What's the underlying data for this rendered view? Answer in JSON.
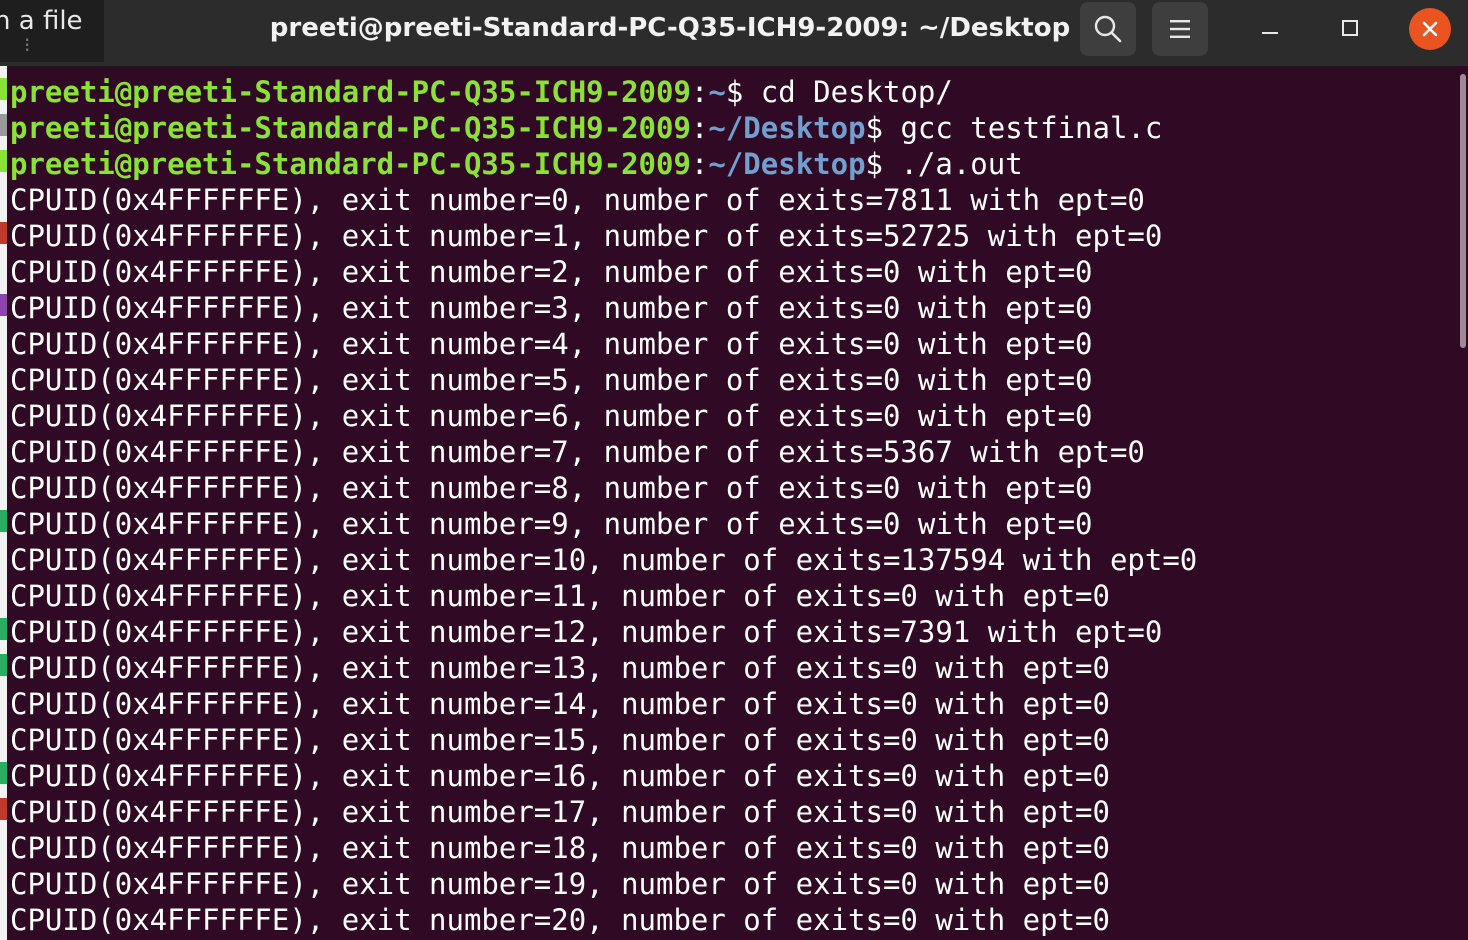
{
  "window": {
    "title": "preeti@preeti-Standard-PC-Q35-ICH9-2009: ~/Desktop",
    "background_tab_text": "n a file",
    "background_tab_sub": "⁝",
    "colors": {
      "terminal_bg": "#300a24",
      "titlebar_bg": "#2c2c2c",
      "prompt_user": "#8ae234",
      "prompt_path": "#729fcf",
      "close_button": "#e95420"
    }
  },
  "header_buttons": {
    "search_icon": "search-icon",
    "menu_icon": "hamburger-menu-icon",
    "minimize_icon": "minimize-icon",
    "maximize_icon": "maximize-icon",
    "close_icon": "close-icon"
  },
  "terminal": {
    "prompts": [
      {
        "user": "preeti@preeti-Standard-PC-Q35-ICH9-2009",
        "colon": ":",
        "path": "~",
        "dollar": "$",
        "command": " cd Desktop/"
      },
      {
        "user": "preeti@preeti-Standard-PC-Q35-ICH9-2009",
        "colon": ":",
        "path": "~/Desktop",
        "dollar": "$",
        "command": " gcc testfinal.c"
      },
      {
        "user": "preeti@preeti-Standard-PC-Q35-ICH9-2009",
        "colon": ":",
        "path": "~/Desktop",
        "dollar": "$",
        "command": " ./a.out"
      }
    ],
    "output": [
      "CPUID(0x4FFFFFFE), exit number=0, number of exits=7811 with ept=0",
      "CPUID(0x4FFFFFFE), exit number=1, number of exits=52725 with ept=0",
      "CPUID(0x4FFFFFFE), exit number=2, number of exits=0 with ept=0",
      "CPUID(0x4FFFFFFE), exit number=3, number of exits=0 with ept=0",
      "CPUID(0x4FFFFFFE), exit number=4, number of exits=0 with ept=0",
      "CPUID(0x4FFFFFFE), exit number=5, number of exits=0 with ept=0",
      "CPUID(0x4FFFFFFE), exit number=6, number of exits=0 with ept=0",
      "CPUID(0x4FFFFFFE), exit number=7, number of exits=5367 with ept=0",
      "CPUID(0x4FFFFFFE), exit number=8, number of exits=0 with ept=0",
      "CPUID(0x4FFFFFFE), exit number=9, number of exits=0 with ept=0",
      "CPUID(0x4FFFFFFE), exit number=10, number of exits=137594 with ept=0",
      "CPUID(0x4FFFFFFE), exit number=11, number of exits=0 with ept=0",
      "CPUID(0x4FFFFFFE), exit number=12, number of exits=7391 with ept=0",
      "CPUID(0x4FFFFFFE), exit number=13, number of exits=0 with ept=0",
      "CPUID(0x4FFFFFFE), exit number=14, number of exits=0 with ept=0",
      "CPUID(0x4FFFFFFE), exit number=15, number of exits=0 with ept=0",
      "CPUID(0x4FFFFFFE), exit number=16, number of exits=0 with ept=0",
      "CPUID(0x4FFFFFFE), exit number=17, number of exits=0 with ept=0",
      "CPUID(0x4FFFFFFE), exit number=18, number of exits=0 with ept=0",
      "CPUID(0x4FFFFFFE), exit number=19, number of exits=0 with ept=0",
      "CPUID(0x4FFFFFFE), exit number=20, number of exits=0 with ept=0"
    ]
  }
}
